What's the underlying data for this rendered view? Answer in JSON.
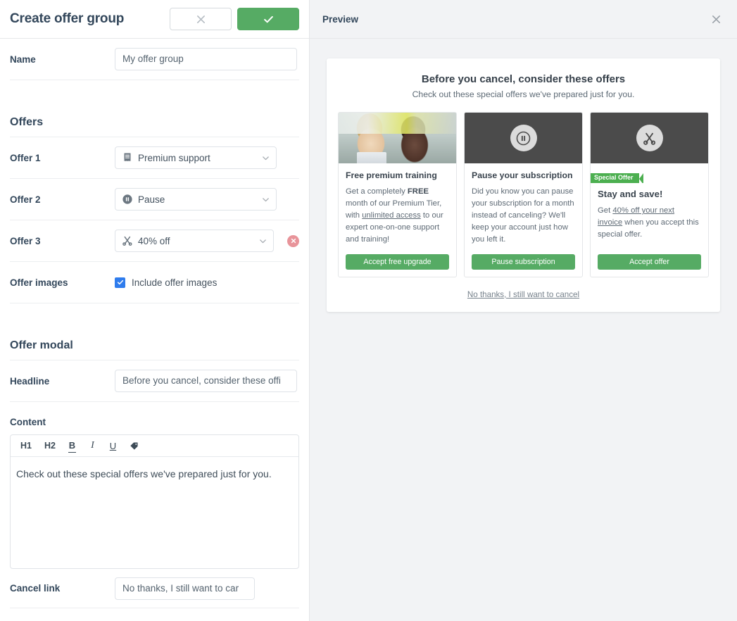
{
  "form": {
    "title": "Create offer group",
    "cancel_icon": "close-icon",
    "confirm_icon": "check-icon",
    "name_label": "Name",
    "name_value": "My offer group",
    "offers_section": "Offers",
    "offers": [
      {
        "label": "Offer 1",
        "icon": "receipt-icon",
        "value": "Premium support",
        "deletable": false
      },
      {
        "label": "Offer 2",
        "icon": "pause-circle-icon",
        "value": "Pause",
        "deletable": false
      },
      {
        "label": "Offer 3",
        "icon": "scissors-icon",
        "value": "40% off",
        "deletable": true
      }
    ],
    "offer_images_label": "Offer images",
    "offer_images_checkbox": "Include offer images",
    "offer_images_checked": true,
    "modal_section": "Offer modal",
    "headline_label": "Headline",
    "headline_value": "Before you cancel, consider these offi",
    "content_label": "Content",
    "toolbar": [
      "H1",
      "H2",
      "B",
      "I",
      "U"
    ],
    "toolbar_tag_icon": "tag-icon",
    "content_value": "Check out these special offers we've prepared just for you.",
    "cancel_link_label": "Cancel link",
    "cancel_link_value": "No thanks, I still want to car"
  },
  "preview": {
    "title": "Preview",
    "close_icon": "close-icon",
    "modal": {
      "headline": "Before you cancel, consider these offers",
      "subhead": "Check out these special offers we've prepared just for you.",
      "cancel_link": "No thanks, I still want to cancel",
      "cards": [
        {
          "image_type": "photo",
          "image_icon": "",
          "badge": "",
          "title": "Free premium training",
          "body_parts": [
            {
              "text": "Get a completely ",
              "style": "normal"
            },
            {
              "text": "FREE",
              "style": "bold"
            },
            {
              "text": " month of our Premium Tier, with ",
              "style": "normal"
            },
            {
              "text": "unlimited access",
              "style": "underline"
            },
            {
              "text": " to our expert one-on-one support and training!",
              "style": "normal"
            }
          ],
          "button": "Accept free upgrade"
        },
        {
          "image_type": "dark",
          "image_icon": "pause-circle-icon",
          "badge": "",
          "title": "Pause your subscription",
          "body_parts": [
            {
              "text": "Did you know you can pause your subscription for a month instead of canceling? We'll keep your account just how you left it.",
              "style": "normal"
            }
          ],
          "button": "Pause subscription"
        },
        {
          "image_type": "dark",
          "image_icon": "scissors-icon",
          "badge": "Special Offer",
          "title": "Stay and save!",
          "body_parts": [
            {
              "text": "Get ",
              "style": "normal"
            },
            {
              "text": "40% off your next invoice",
              "style": "underline"
            },
            {
              "text": " when you accept this special offer.",
              "style": "normal"
            }
          ],
          "button": "Accept offer"
        }
      ]
    }
  },
  "colors": {
    "green": "#56ab64",
    "ribbon_green": "#4caf50",
    "checkbox_blue": "#2f7ced",
    "delete_red": "#e8949a",
    "panel_gray": "#f2f3f5",
    "card_dark": "#4b4b4b"
  }
}
